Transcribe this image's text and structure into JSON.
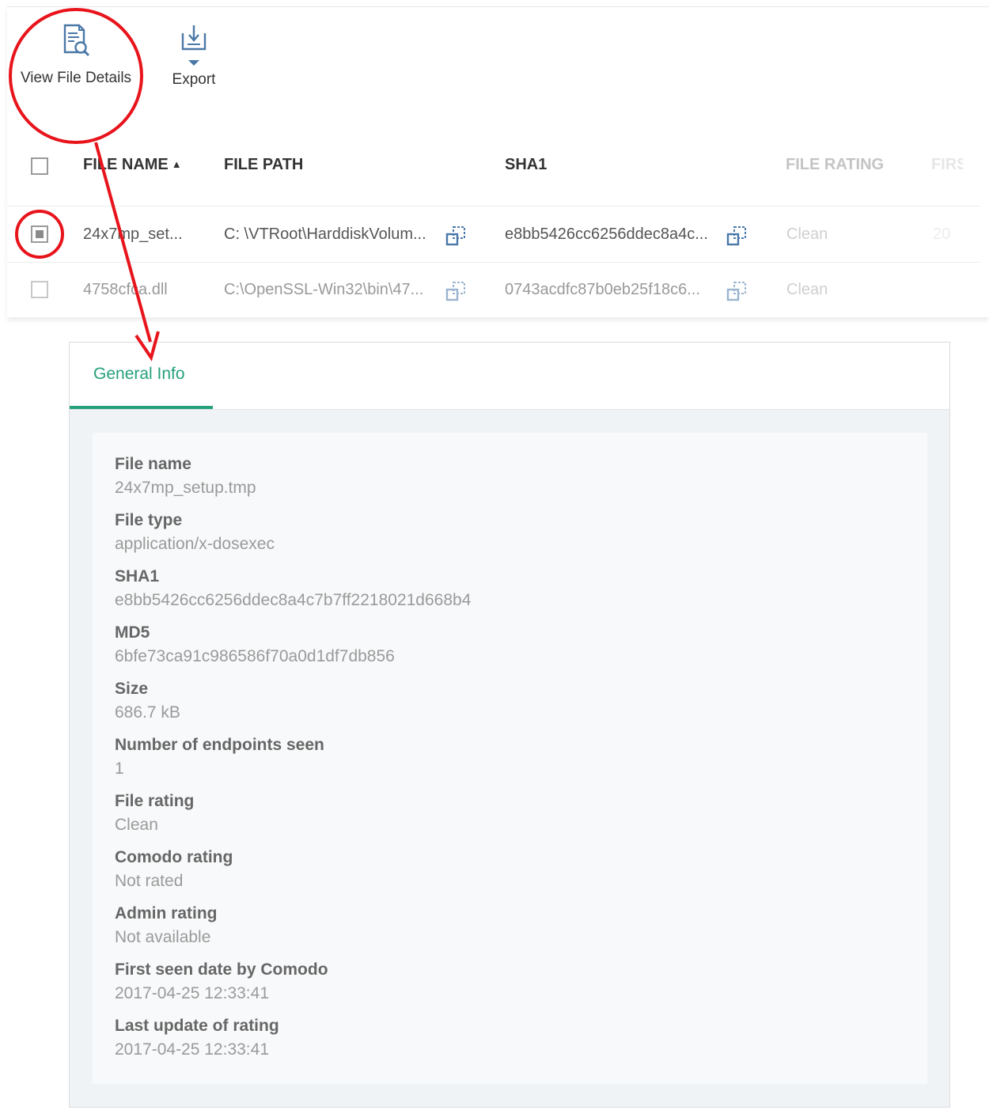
{
  "toolbar": {
    "view_file_details_label": "View File Details",
    "export_label": "Export"
  },
  "table": {
    "columns": [
      {
        "label": "FILE NAME",
        "sort": "ascending"
      },
      {
        "label": "FILE PATH"
      },
      {
        "label": "SHA1"
      },
      {
        "label": "FILE RATING"
      },
      {
        "label": "FIRS"
      }
    ],
    "rows": [
      {
        "checked": true,
        "file_name": "24x7mp_set...",
        "file_path": "C: \\VTRoot\\HarddiskVolum...",
        "sha1": "e8bb5426cc6256ddec8a4c...",
        "file_rating": "Clean",
        "first": "20"
      },
      {
        "checked": false,
        "file_name": "4758cfca.dll",
        "file_path": "C:\\OpenSSL-Win32\\bin\\47...",
        "sha1": "0743acdfc87b0eb25f18c6...",
        "file_rating": "Clean"
      }
    ]
  },
  "details": {
    "tab_label": "General Info",
    "fields": [
      {
        "label": "File name",
        "value": "24x7mp_setup.tmp"
      },
      {
        "label": "File type",
        "value": "application/x-dosexec"
      },
      {
        "label": "SHA1",
        "value": "e8bb5426cc6256ddec8a4c7b7ff2218021d668b4"
      },
      {
        "label": "MD5",
        "value": "6bfe73ca91c986586f70a0d1df7db856"
      },
      {
        "label": "Size",
        "value": "686.7 kB"
      },
      {
        "label": "Number of endpoints seen",
        "value": "1"
      },
      {
        "label": "File rating",
        "value": "Clean"
      },
      {
        "label": "Comodo rating",
        "value": "Not rated"
      },
      {
        "label": "Admin rating",
        "value": "Not available"
      },
      {
        "label": "First seen date by Comodo",
        "value": "2017-04-25 12:33:41"
      },
      {
        "label": "Last update of rating",
        "value": "2017-04-25 12:33:41"
      }
    ]
  },
  "colors": {
    "accent": "#27a07c",
    "annotation": "#e8141c"
  },
  "icons": {
    "view_file_details": "document-search-icon",
    "export": "download-tray-icon",
    "copy": "copy-icon"
  }
}
